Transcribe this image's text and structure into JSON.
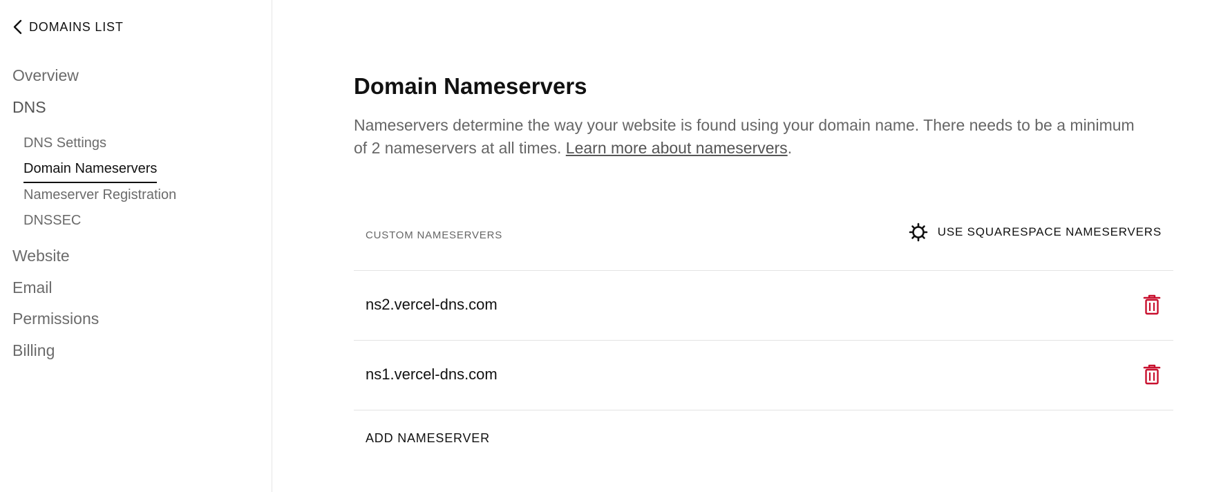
{
  "sidebar": {
    "back_label": "DOMAINS LIST",
    "top_items": [
      "Overview",
      "DNS"
    ],
    "dns_items": [
      "DNS Settings",
      "Domain Nameservers",
      "Nameserver Registration",
      "DNSSEC"
    ],
    "bottom_items": [
      "Website",
      "Email",
      "Permissions",
      "Billing"
    ],
    "active_item": "Domain Nameservers"
  },
  "main": {
    "title": "Domain Nameservers",
    "description_text": "Nameservers determine the way your website is found using your domain name. There needs to be a minimum of 2 nameservers at all times. ",
    "learn_more_link": "Learn more about nameservers",
    "description_end": ".",
    "section_label": "CUSTOM NAMESERVERS",
    "use_default_label": "USE SQUARESPACE NAMESERVERS",
    "nameservers": [
      "ns2.vercel-dns.com",
      "ns1.vercel-dns.com"
    ],
    "add_label": "ADD NAMESERVER"
  },
  "icons": {
    "back": "chevron-left-icon",
    "gear": "gear-icon",
    "delete": "trash-icon"
  },
  "colors": {
    "delete_red": "#c8102e",
    "text_primary": "#111111",
    "text_muted": "#666666"
  }
}
